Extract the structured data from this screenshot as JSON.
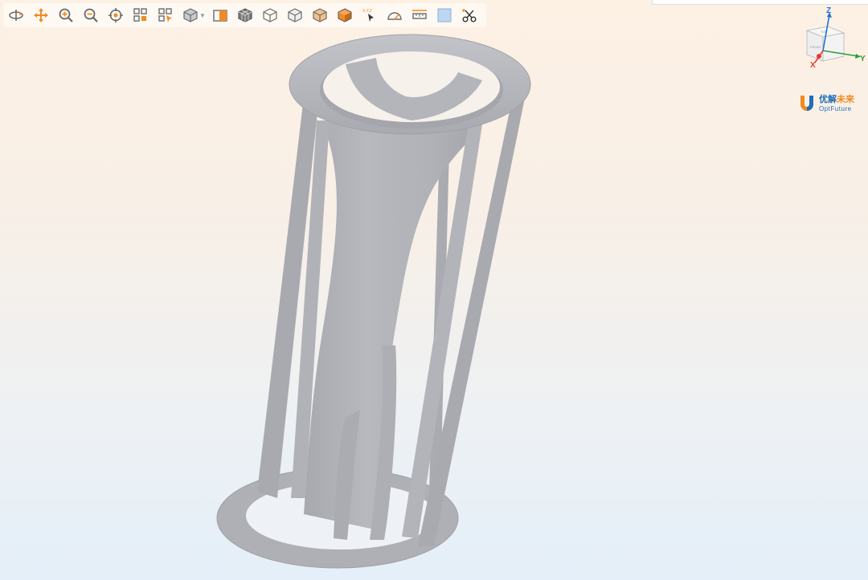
{
  "toolbar": {
    "buttons": [
      {
        "name": "rotate-button",
        "icon": "rotate-icon"
      },
      {
        "name": "pan-button",
        "icon": "pan-icon"
      },
      {
        "name": "zoom-in-button",
        "icon": "zoom-in-icon"
      },
      {
        "name": "zoom-out-button",
        "icon": "zoom-out-icon"
      },
      {
        "name": "fit-view-button",
        "icon": "target-icon"
      },
      {
        "name": "box-select-button",
        "icon": "box-select-icon"
      },
      {
        "name": "box-select-cursor-button",
        "icon": "box-select-cursor-icon"
      },
      {
        "name": "view-cube-button",
        "icon": "cube-icon"
      },
      {
        "name": "section-view-button",
        "icon": "section-icon"
      },
      {
        "name": "mesh-view-button",
        "icon": "mesh-cube-icon"
      },
      {
        "name": "wireframe-view-button",
        "icon": "wireframe-cube-icon"
      },
      {
        "name": "hidden-line-view-button",
        "icon": "hidden-line-cube-icon"
      },
      {
        "name": "shaded-view-button",
        "icon": "shaded-cube-icon"
      },
      {
        "name": "solid-view-button",
        "icon": "solid-cube-icon"
      },
      {
        "name": "coordinate-pick-button",
        "icon": "coordinate-cursor-icon",
        "label": "X,Y,Z"
      },
      {
        "name": "angle-measure-button",
        "icon": "protractor-icon"
      },
      {
        "name": "distance-measure-button",
        "icon": "ruler-icon"
      },
      {
        "name": "background-color-button",
        "icon": "color-swatch-icon"
      },
      {
        "name": "clip-tool-button",
        "icon": "scissors-icon"
      }
    ]
  },
  "axes": {
    "x": "X",
    "y": "Y",
    "z": "Z"
  },
  "viewcube": {
    "front_label": "FRONT",
    "top_label": "TOP"
  },
  "logo": {
    "cn_blue": "优解",
    "cn_orange": "未来",
    "en": "OptFuture"
  },
  "colors": {
    "accent": "#f08a24",
    "icon_gray": "#6b6b6b",
    "model_gray": "#b3b5ba",
    "axis_x": "#e53935",
    "axis_y": "#2e9b3a",
    "axis_z": "#1e74d9",
    "brand_blue": "#1d6fb8"
  }
}
